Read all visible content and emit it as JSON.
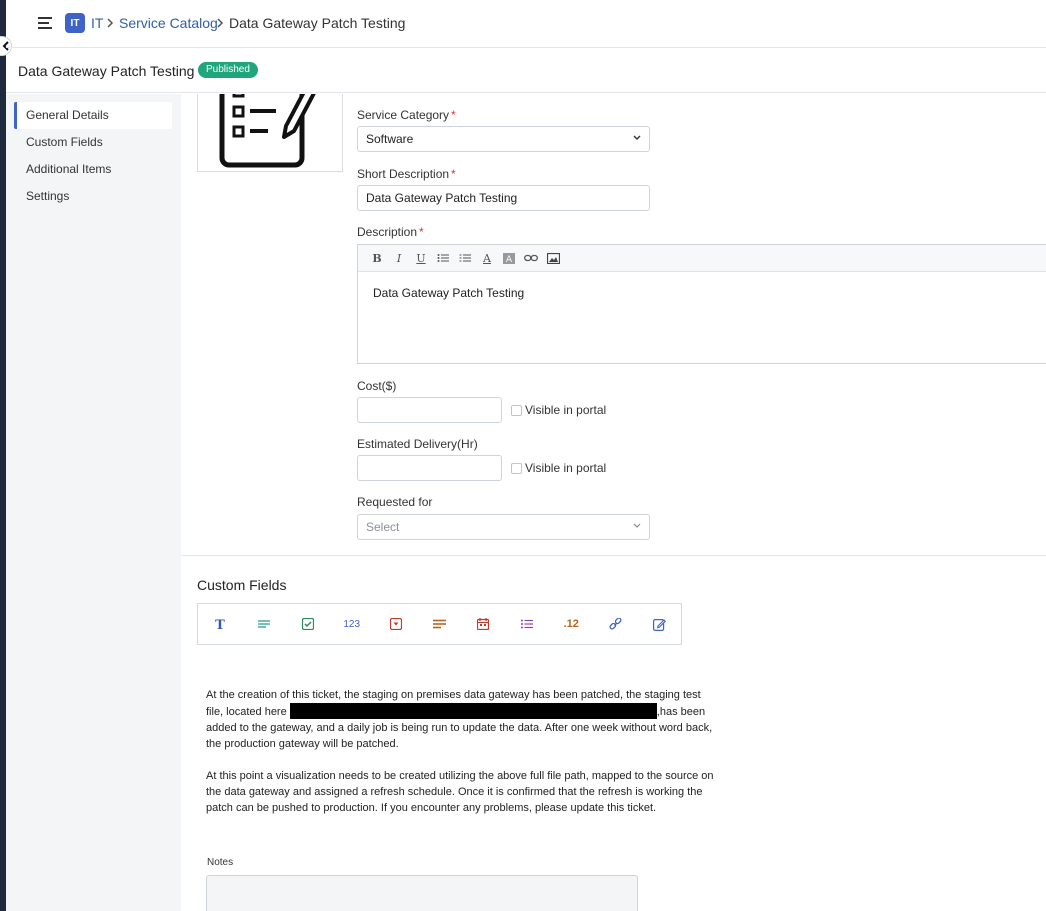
{
  "breadcrumb": {
    "badge": "IT",
    "items": [
      "IT",
      "Service Catalog",
      "Data Gateway Patch Testing"
    ]
  },
  "header": {
    "title": "Data Gateway Patch Testing",
    "status": "Published",
    "status_color": "#1fa67a"
  },
  "sidebar": {
    "items": [
      {
        "label": "General Details",
        "active": true
      },
      {
        "label": "Custom Fields"
      },
      {
        "label": "Additional Items"
      },
      {
        "label": "Settings"
      }
    ]
  },
  "form": {
    "service_category": {
      "label": "Service Category",
      "required_mark": "*",
      "value": "Software"
    },
    "short_description": {
      "label": "Short Description",
      "required_mark": "*",
      "value": "Data Gateway Patch Testing"
    },
    "description": {
      "label": "Description",
      "required_mark": "*",
      "toolbar": [
        "B",
        "I",
        "U",
        "bulleted-list-icon",
        "numbered-list-icon",
        "A",
        "highlight-icon",
        "link-icon",
        "image-icon"
      ],
      "value": "Data Gateway Patch Testing"
    },
    "cost": {
      "label": "Cost($)",
      "value": "",
      "visible_label": "Visible in portal"
    },
    "delivery": {
      "label": "Estimated Delivery(Hr)",
      "value": "",
      "visible_label": "Visible in portal"
    },
    "requested_for": {
      "label": "Requested for",
      "placeholder": "Select"
    }
  },
  "custom_fields": {
    "title": "Custom Fields",
    "tools": [
      "text-icon",
      "paragraph-icon",
      "checkbox-icon",
      "number-icon",
      "dropdown-icon",
      "multi-line-icon",
      "date-icon",
      "list-icon",
      "decimal-icon",
      "link-icon",
      "edit-icon"
    ],
    "tool_labels": {
      "number": "123",
      "decimal": ".12"
    }
  },
  "notes_content": {
    "para1_before": "At the creation of this ticket, the staging on premises data gateway has been patched, the staging test file, located here ",
    "para1_after": ",has been added to the gateway, and a daily job is being run to update the data. After one week without word back, the production gateway will be patched.",
    "para2": "At this point a visualization needs to be created utilizing the above full file path, mapped to the source on the data gateway and assigned a refresh schedule. Once it is confirmed that the refresh is working the patch can be pushed to production. If you encounter any problems, please update this ticket."
  },
  "notes": {
    "label": "Notes",
    "value": ""
  },
  "colors": {
    "accent": "#3f63c8",
    "link": "#2f5ea8",
    "rail": "#1f2a3c"
  }
}
